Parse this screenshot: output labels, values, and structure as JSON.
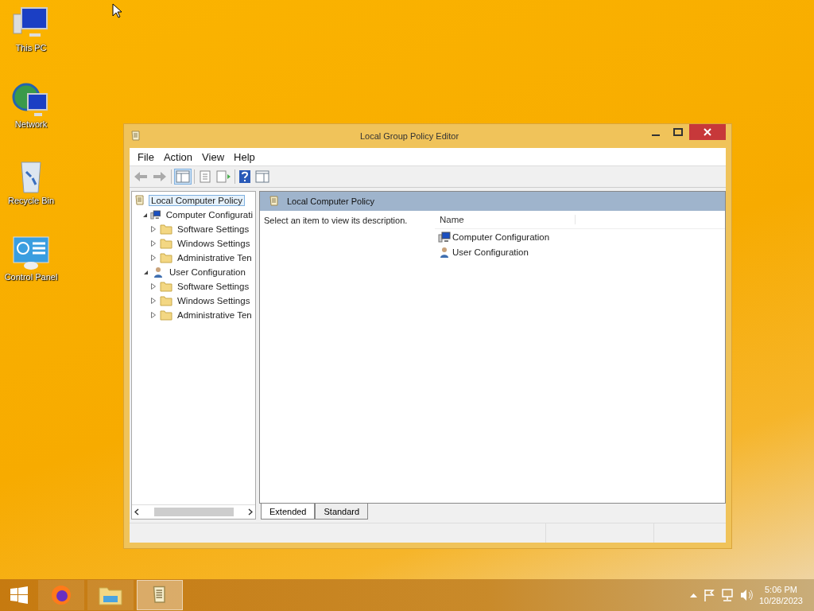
{
  "desktop_icons": [
    {
      "label": "This PC",
      "kind": "pc"
    },
    {
      "label": "Network",
      "kind": "network"
    },
    {
      "label": "Recycle Bin",
      "kind": "recycle"
    },
    {
      "label": "Control Panel",
      "kind": "control"
    }
  ],
  "window": {
    "title": "Local Group Policy Editor",
    "menu": [
      "File",
      "Action",
      "View",
      "Help"
    ],
    "tree": [
      {
        "label": "Local Computer Policy",
        "kind": "policy",
        "selected": true,
        "children": [
          {
            "label": "Computer Configurati",
            "kind": "computer",
            "expanded": true,
            "selected": false,
            "children": [
              {
                "label": "Software Settings",
                "kind": "folder",
                "expanded": false,
                "selected": false
              },
              {
                "label": "Windows Settings",
                "kind": "folder",
                "expanded": false,
                "selected": false
              },
              {
                "label": "Administrative Ten",
                "kind": "folder",
                "expanded": false,
                "selected": false
              }
            ]
          },
          {
            "label": "User Configuration",
            "kind": "user",
            "expanded": true,
            "selected": false,
            "children": [
              {
                "label": "Software Settings",
                "kind": "folder",
                "expanded": false,
                "selected": false
              },
              {
                "label": "Windows Settings",
                "kind": "folder",
                "expanded": false,
                "selected": false
              },
              {
                "label": "Administrative Ten",
                "kind": "folder",
                "expanded": false,
                "selected": false
              }
            ]
          }
        ]
      }
    ],
    "header": "Local Computer Policy",
    "description": "Select an item to view its description.",
    "list": {
      "columns": [
        "Name"
      ],
      "items": [
        {
          "label": "Computer Configuration",
          "kind": "computer"
        },
        {
          "label": "User Configuration",
          "kind": "user"
        }
      ]
    },
    "tabs": [
      {
        "label": "Extended",
        "selected": true
      },
      {
        "label": "Standard",
        "selected": false
      }
    ]
  },
  "taskbar": {
    "apps": [
      {
        "kind": "firefox",
        "selected": false
      },
      {
        "kind": "explorer",
        "selected": false
      },
      {
        "kind": "policy",
        "selected": true
      }
    ],
    "time": "5:06 PM",
    "date": "10/28/2023"
  }
}
